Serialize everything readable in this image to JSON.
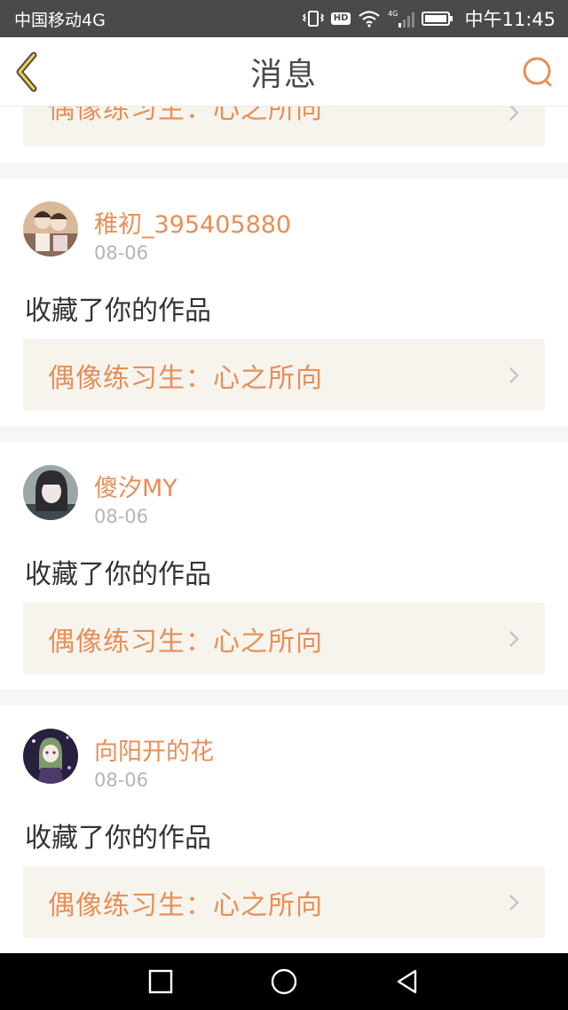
{
  "status_bar": {
    "carrier": "中国移动4G",
    "hd_badge": "HD",
    "network": "4G",
    "time": "中午11:45"
  },
  "header": {
    "title": "消息",
    "back_icon": "chevron-left-icon",
    "search_icon": "search-icon",
    "accent_color": "#e98e56"
  },
  "partial_card": {
    "work_title": "偶像练习生：心之所向"
  },
  "messages": [
    {
      "username": "稚初_395405880",
      "date": "08-06",
      "action": "收藏了你的作品",
      "work_title": "偶像练习生：心之所向"
    },
    {
      "username": "傻汐MY",
      "date": "08-06",
      "action": "收藏了你的作品",
      "work_title": "偶像练习生：心之所向"
    },
    {
      "username": "向阳开的花",
      "date": "08-06",
      "action": "收藏了你的作品",
      "work_title": "偶像练习生：心之所向"
    }
  ],
  "nav_bar": {
    "recent_icon": "square-icon",
    "home_icon": "circle-icon",
    "back_icon": "triangle-back-icon"
  }
}
